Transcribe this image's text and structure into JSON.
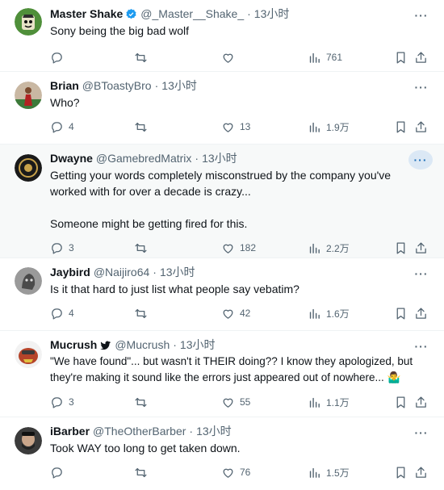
{
  "tweets": [
    {
      "name": "Master Shake",
      "verified": true,
      "handle": "@_Master__Shake_",
      "time": "13小时",
      "text": "Sony being the big bad wolf",
      "replies": "",
      "retweets": "",
      "likes": "",
      "views": "761",
      "highlighted": false
    },
    {
      "name": "Brian",
      "verified": false,
      "handle": "@BToastyBro",
      "time": "13小时",
      "text": "Who?",
      "replies": "4",
      "retweets": "",
      "likes": "13",
      "views": "1.9万",
      "highlighted": false
    },
    {
      "name": "Dwayne",
      "verified": false,
      "handle": "@GamebredMatrix",
      "time": "13小时",
      "text": "Getting your words completely misconstrued by the company you've\nworked with for over a decade is crazy...\n\nSomeone might be getting fired for this.",
      "replies": "3",
      "retweets": "",
      "likes": "182",
      "views": "2.2万",
      "highlighted": true
    },
    {
      "name": "Jaybird",
      "verified": false,
      "handle": "@Naijiro64",
      "time": "13小时",
      "text": "Is it that hard to just list what people say vebatim?",
      "replies": "4",
      "retweets": "",
      "likes": "42",
      "views": "1.6万",
      "highlighted": false
    },
    {
      "name": "Mucrush",
      "verified": false,
      "bird_badge": true,
      "handle": "@Mucrush",
      "time": "13小时",
      "text": "\"We have found\"... but wasn't it THEIR doing?? I know they apologized, but\nthey're making it sound like the errors just appeared out of nowhere... 🤷‍♂️",
      "replies": "3",
      "retweets": "",
      "likes": "55",
      "views": "1.1万",
      "highlighted": false
    },
    {
      "name": "iBarber",
      "verified": false,
      "handle": "@TheOtherBarber",
      "time": "13小时",
      "text": "Took WAY too long to get taken down.",
      "replies": "",
      "retweets": "",
      "likes": "76",
      "views": "1.5万",
      "highlighted": false
    }
  ],
  "ui": {
    "more_label": "···"
  },
  "icons": {
    "reply": "reply-icon",
    "retweet": "retweet-icon",
    "like": "heart-icon",
    "views": "views-chart-icon",
    "bookmark": "bookmark-icon",
    "share": "share-icon",
    "verified": "verified-badge-icon",
    "bird": "twitter-bird-icon"
  },
  "colors": {
    "text": "#0f1419",
    "secondary": "#536471",
    "verified": "#1d9bf0",
    "highlight_bg": "#f7f9f9"
  }
}
